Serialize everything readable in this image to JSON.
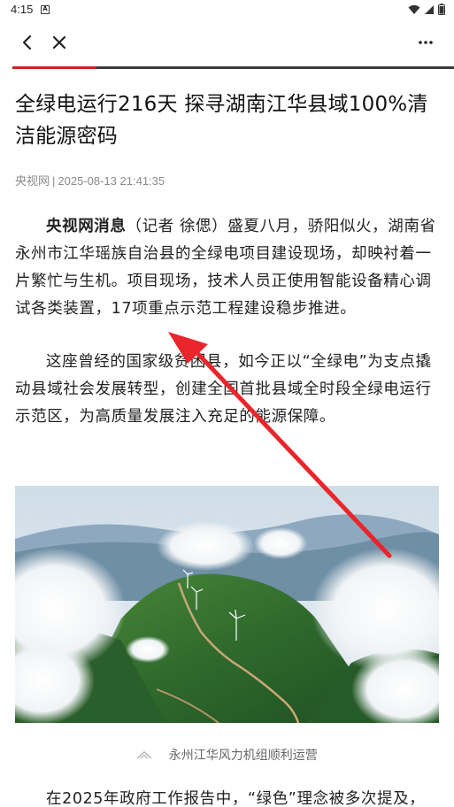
{
  "status_bar": {
    "time": "4:15",
    "app_badge": "A"
  },
  "nav": {
    "back_icon": "back-arrow-icon",
    "close_icon": "close-icon",
    "more_icon": "more-icon"
  },
  "progress": {
    "fraction": 0.19,
    "color": "#cc2222"
  },
  "article": {
    "title": "全绿电运行216天 探寻湖南江华县域100%清洁能源密码",
    "source": "央视网",
    "separator": "|",
    "datetime": "2025-08-13 21:41:35",
    "p1_lead": "央视网消息",
    "p1_text": "（记者 徐偲）盛夏八月，骄阳似火，湖南省永州市江华瑶族自治县的全绿电项目建设现场，却映衬着一片繁忙与生机。项目现场，技术人员正使用智能设备精心调试各类装置，17项重点示范工程建设稳步推进。",
    "p2_text": "这座曾经的国家级贫困县，如今正以“全绿电”为支点撬动县域社会发展转型，创建全国首批县域全时段全绿电运行示范区，为高质量发展注入充足的能源保障。",
    "image_caption": "永州江华风力机组顺利运营",
    "p3_text": "在2025年政府工作报告中，“绿色”理念被多次提及，"
  },
  "annotation": {
    "type": "arrow",
    "color": "#e8262b"
  }
}
